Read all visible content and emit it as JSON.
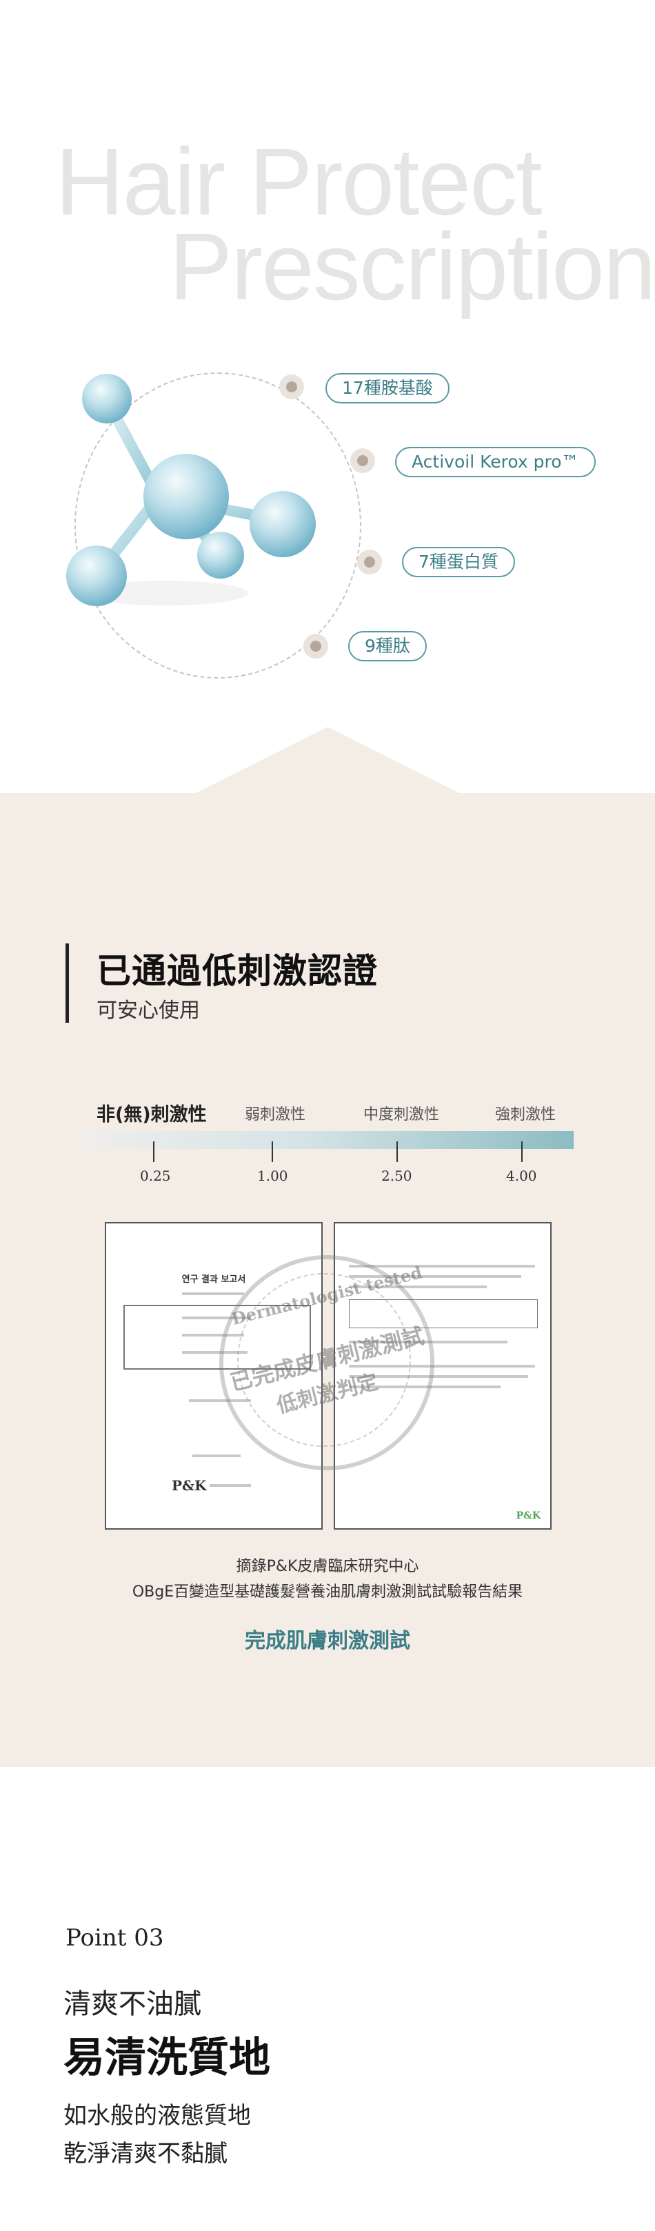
{
  "hero": {
    "line1": "Hair Protect",
    "line2": "Prescription"
  },
  "ingredients": [
    {
      "label": "17種胺基酸"
    },
    {
      "label": "Activoil Kerox pro™"
    },
    {
      "label": "7種蛋白質"
    },
    {
      "label": "9種肽"
    }
  ],
  "certification": {
    "title": "已通過低刺激認證",
    "subtitle": "可安心使用"
  },
  "scale": {
    "labels": [
      "非(無)刺激性",
      "弱刺激性",
      "中度刺激性",
      "強刺激性"
    ],
    "ticks": [
      "0.25",
      "1.00",
      "2.50",
      "4.00"
    ]
  },
  "stamp": {
    "ring": "Dermatologist tested",
    "line1": "已完成皮膚刺激測試",
    "line2": "低刺激判定"
  },
  "report": {
    "doc_title": "연구 결과 보고서",
    "logo": "P&K",
    "caption1": "摘錄P&K皮膚臨床研究中心",
    "caption2": "OBgE百變造型基礎護髮營養油肌膚刺激測試試驗報告結果",
    "highlight": "完成肌膚刺激測試"
  },
  "point": {
    "label": "Point 03",
    "subtitle": "清爽不油膩",
    "title": "易清洗質地",
    "desc1": "如水般的液態質地",
    "desc2": "乾淨清爽不黏膩"
  },
  "colors": {
    "teal": "#3c7e88",
    "beige": "#f4ede6",
    "hero_text": "#e7e5e3"
  }
}
